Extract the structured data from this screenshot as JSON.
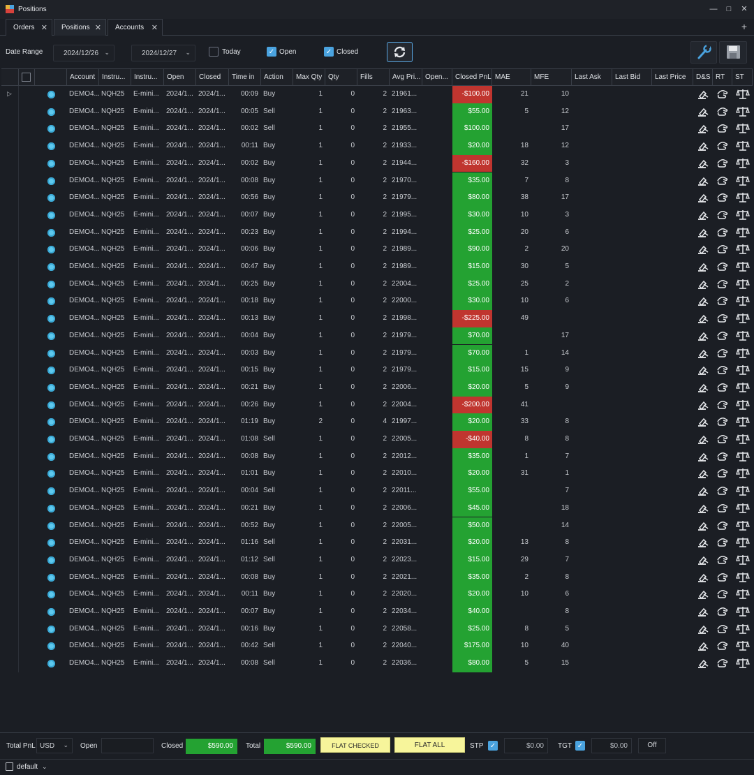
{
  "window": {
    "title": "Positions"
  },
  "tabs": [
    {
      "label": "Orders",
      "active": false
    },
    {
      "label": "Positions",
      "active": true
    },
    {
      "label": "Accounts",
      "active": false
    }
  ],
  "toolbar": {
    "date_range_label": "Date Range",
    "date_from": "2024/12/26",
    "date_to": "2024/12/27",
    "today_label": "Today",
    "today_checked": false,
    "open_label": "Open",
    "open_checked": true,
    "closed_label": "Closed",
    "closed_checked": true
  },
  "columns": [
    "Account",
    "Instru...",
    "Instru...",
    "Open",
    "Closed",
    "Time in",
    "Action",
    "Max Qty",
    "Qty",
    "Fills",
    "Avg Pri...",
    "Open...",
    "Closed PnL",
    "MAE",
    "MFE",
    "Last Ask",
    "Last Bid",
    "Last Price",
    "D&S",
    "RT",
    "ST"
  ],
  "colors": {
    "positive": "#24a232",
    "negative": "#c0352f",
    "accent": "#4aa3df"
  },
  "rows": [
    {
      "account": "DEMO4...",
      "instrument": "NQH25",
      "instrument_name": "E-mini...",
      "open": "2024/1...",
      "closed": "2024/1...",
      "time_in": "00:09",
      "action": "Buy",
      "max_qty": "1",
      "qty": "0",
      "fills": "2",
      "avg_price": "21961...",
      "closed_pnl": "-$100.00",
      "mae": "21",
      "mfe": "10"
    },
    {
      "account": "DEMO4...",
      "instrument": "NQH25",
      "instrument_name": "E-mini...",
      "open": "2024/1...",
      "closed": "2024/1...",
      "time_in": "00:05",
      "action": "Sell",
      "max_qty": "1",
      "qty": "0",
      "fills": "2",
      "avg_price": "21963...",
      "closed_pnl": "$55.00",
      "mae": "5",
      "mfe": "12"
    },
    {
      "account": "DEMO4...",
      "instrument": "NQH25",
      "instrument_name": "E-mini...",
      "open": "2024/1...",
      "closed": "2024/1...",
      "time_in": "00:02",
      "action": "Sell",
      "max_qty": "1",
      "qty": "0",
      "fills": "2",
      "avg_price": "21955...",
      "closed_pnl": "$100.00",
      "mae": "",
      "mfe": "17"
    },
    {
      "account": "DEMO4...",
      "instrument": "NQH25",
      "instrument_name": "E-mini...",
      "open": "2024/1...",
      "closed": "2024/1...",
      "time_in": "00:11",
      "action": "Buy",
      "max_qty": "1",
      "qty": "0",
      "fills": "2",
      "avg_price": "21933...",
      "closed_pnl": "$20.00",
      "mae": "18",
      "mfe": "12"
    },
    {
      "account": "DEMO4...",
      "instrument": "NQH25",
      "instrument_name": "E-mini...",
      "open": "2024/1...",
      "closed": "2024/1...",
      "time_in": "00:02",
      "action": "Buy",
      "max_qty": "1",
      "qty": "0",
      "fills": "2",
      "avg_price": "21944...",
      "closed_pnl": "-$160.00",
      "mae": "32",
      "mfe": "3"
    },
    {
      "account": "DEMO4...",
      "instrument": "NQH25",
      "instrument_name": "E-mini...",
      "open": "2024/1...",
      "closed": "2024/1...",
      "time_in": "00:08",
      "action": "Buy",
      "max_qty": "1",
      "qty": "0",
      "fills": "2",
      "avg_price": "21970...",
      "closed_pnl": "$35.00",
      "mae": "7",
      "mfe": "8"
    },
    {
      "account": "DEMO4...",
      "instrument": "NQH25",
      "instrument_name": "E-mini...",
      "open": "2024/1...",
      "closed": "2024/1...",
      "time_in": "00:56",
      "action": "Buy",
      "max_qty": "1",
      "qty": "0",
      "fills": "2",
      "avg_price": "21979...",
      "closed_pnl": "$80.00",
      "mae": "38",
      "mfe": "17"
    },
    {
      "account": "DEMO4...",
      "instrument": "NQH25",
      "instrument_name": "E-mini...",
      "open": "2024/1...",
      "closed": "2024/1...",
      "time_in": "00:07",
      "action": "Buy",
      "max_qty": "1",
      "qty": "0",
      "fills": "2",
      "avg_price": "21995...",
      "closed_pnl": "$30.00",
      "mae": "10",
      "mfe": "3"
    },
    {
      "account": "DEMO4...",
      "instrument": "NQH25",
      "instrument_name": "E-mini...",
      "open": "2024/1...",
      "closed": "2024/1...",
      "time_in": "00:23",
      "action": "Buy",
      "max_qty": "1",
      "qty": "0",
      "fills": "2",
      "avg_price": "21994...",
      "closed_pnl": "$25.00",
      "mae": "20",
      "mfe": "6"
    },
    {
      "account": "DEMO4...",
      "instrument": "NQH25",
      "instrument_name": "E-mini...",
      "open": "2024/1...",
      "closed": "2024/1...",
      "time_in": "00:06",
      "action": "Buy",
      "max_qty": "1",
      "qty": "0",
      "fills": "2",
      "avg_price": "21989...",
      "closed_pnl": "$90.00",
      "mae": "2",
      "mfe": "20"
    },
    {
      "account": "DEMO4...",
      "instrument": "NQH25",
      "instrument_name": "E-mini...",
      "open": "2024/1...",
      "closed": "2024/1...",
      "time_in": "00:47",
      "action": "Buy",
      "max_qty": "1",
      "qty": "0",
      "fills": "2",
      "avg_price": "21989...",
      "closed_pnl": "$15.00",
      "mae": "30",
      "mfe": "5"
    },
    {
      "account": "DEMO4...",
      "instrument": "NQH25",
      "instrument_name": "E-mini...",
      "open": "2024/1...",
      "closed": "2024/1...",
      "time_in": "00:25",
      "action": "Buy",
      "max_qty": "1",
      "qty": "0",
      "fills": "2",
      "avg_price": "22004...",
      "closed_pnl": "$25.00",
      "mae": "25",
      "mfe": "2"
    },
    {
      "account": "DEMO4...",
      "instrument": "NQH25",
      "instrument_name": "E-mini...",
      "open": "2024/1...",
      "closed": "2024/1...",
      "time_in": "00:18",
      "action": "Buy",
      "max_qty": "1",
      "qty": "0",
      "fills": "2",
      "avg_price": "22000...",
      "closed_pnl": "$30.00",
      "mae": "10",
      "mfe": "6"
    },
    {
      "account": "DEMO4...",
      "instrument": "NQH25",
      "instrument_name": "E-mini...",
      "open": "2024/1...",
      "closed": "2024/1...",
      "time_in": "00:13",
      "action": "Buy",
      "max_qty": "1",
      "qty": "0",
      "fills": "2",
      "avg_price": "21998...",
      "closed_pnl": "-$225.00",
      "mae": "49",
      "mfe": ""
    },
    {
      "account": "DEMO4...",
      "instrument": "NQH25",
      "instrument_name": "E-mini...",
      "open": "2024/1...",
      "closed": "2024/1...",
      "time_in": "00:04",
      "action": "Buy",
      "max_qty": "1",
      "qty": "0",
      "fills": "2",
      "avg_price": "21979...",
      "closed_pnl": "$70.00",
      "mae": "",
      "mfe": "17"
    },
    {
      "account": "DEMO4...",
      "instrument": "NQH25",
      "instrument_name": "E-mini...",
      "open": "2024/1...",
      "closed": "2024/1...",
      "time_in": "00:03",
      "action": "Buy",
      "max_qty": "1",
      "qty": "0",
      "fills": "2",
      "avg_price": "21979...",
      "closed_pnl": "$70.00",
      "mae": "1",
      "mfe": "14"
    },
    {
      "account": "DEMO4...",
      "instrument": "NQH25",
      "instrument_name": "E-mini...",
      "open": "2024/1...",
      "closed": "2024/1...",
      "time_in": "00:15",
      "action": "Buy",
      "max_qty": "1",
      "qty": "0",
      "fills": "2",
      "avg_price": "21979...",
      "closed_pnl": "$15.00",
      "mae": "15",
      "mfe": "9"
    },
    {
      "account": "DEMO4...",
      "instrument": "NQH25",
      "instrument_name": "E-mini...",
      "open": "2024/1...",
      "closed": "2024/1...",
      "time_in": "00:21",
      "action": "Buy",
      "max_qty": "1",
      "qty": "0",
      "fills": "2",
      "avg_price": "22006...",
      "closed_pnl": "$20.00",
      "mae": "5",
      "mfe": "9"
    },
    {
      "account": "DEMO4...",
      "instrument": "NQH25",
      "instrument_name": "E-mini...",
      "open": "2024/1...",
      "closed": "2024/1...",
      "time_in": "00:26",
      "action": "Buy",
      "max_qty": "1",
      "qty": "0",
      "fills": "2",
      "avg_price": "22004...",
      "closed_pnl": "-$200.00",
      "mae": "41",
      "mfe": ""
    },
    {
      "account": "DEMO4...",
      "instrument": "NQH25",
      "instrument_name": "E-mini...",
      "open": "2024/1...",
      "closed": "2024/1...",
      "time_in": "01:19",
      "action": "Buy",
      "max_qty": "2",
      "qty": "0",
      "fills": "4",
      "avg_price": "21997...",
      "closed_pnl": "$20.00",
      "mae": "33",
      "mfe": "8"
    },
    {
      "account": "DEMO4...",
      "instrument": "NQH25",
      "instrument_name": "E-mini...",
      "open": "2024/1...",
      "closed": "2024/1...",
      "time_in": "01:08",
      "action": "Sell",
      "max_qty": "1",
      "qty": "0",
      "fills": "2",
      "avg_price": "22005...",
      "closed_pnl": "-$40.00",
      "mae": "8",
      "mfe": "8"
    },
    {
      "account": "DEMO4...",
      "instrument": "NQH25",
      "instrument_name": "E-mini...",
      "open": "2024/1...",
      "closed": "2024/1...",
      "time_in": "00:08",
      "action": "Buy",
      "max_qty": "1",
      "qty": "0",
      "fills": "2",
      "avg_price": "22012...",
      "closed_pnl": "$35.00",
      "mae": "1",
      "mfe": "7"
    },
    {
      "account": "DEMO4...",
      "instrument": "NQH25",
      "instrument_name": "E-mini...",
      "open": "2024/1...",
      "closed": "2024/1...",
      "time_in": "01:01",
      "action": "Buy",
      "max_qty": "1",
      "qty": "0",
      "fills": "2",
      "avg_price": "22010...",
      "closed_pnl": "$20.00",
      "mae": "31",
      "mfe": "1"
    },
    {
      "account": "DEMO4...",
      "instrument": "NQH25",
      "instrument_name": "E-mini...",
      "open": "2024/1...",
      "closed": "2024/1...",
      "time_in": "00:04",
      "action": "Sell",
      "max_qty": "1",
      "qty": "0",
      "fills": "2",
      "avg_price": "22011...",
      "closed_pnl": "$55.00",
      "mae": "",
      "mfe": "7"
    },
    {
      "account": "DEMO4...",
      "instrument": "NQH25",
      "instrument_name": "E-mini...",
      "open": "2024/1...",
      "closed": "2024/1...",
      "time_in": "00:21",
      "action": "Buy",
      "max_qty": "1",
      "qty": "0",
      "fills": "2",
      "avg_price": "22006...",
      "closed_pnl": "$45.00",
      "mae": "",
      "mfe": "18"
    },
    {
      "account": "DEMO4...",
      "instrument": "NQH25",
      "instrument_name": "E-mini...",
      "open": "2024/1...",
      "closed": "2024/1...",
      "time_in": "00:52",
      "action": "Buy",
      "max_qty": "1",
      "qty": "0",
      "fills": "2",
      "avg_price": "22005...",
      "closed_pnl": "$50.00",
      "mae": "",
      "mfe": "14"
    },
    {
      "account": "DEMO4...",
      "instrument": "NQH25",
      "instrument_name": "E-mini...",
      "open": "2024/1...",
      "closed": "2024/1...",
      "time_in": "01:16",
      "action": "Sell",
      "max_qty": "1",
      "qty": "0",
      "fills": "2",
      "avg_price": "22031...",
      "closed_pnl": "$20.00",
      "mae": "13",
      "mfe": "8"
    },
    {
      "account": "DEMO4...",
      "instrument": "NQH25",
      "instrument_name": "E-mini...",
      "open": "2024/1...",
      "closed": "2024/1...",
      "time_in": "01:12",
      "action": "Sell",
      "max_qty": "1",
      "qty": "0",
      "fills": "2",
      "avg_price": "22023...",
      "closed_pnl": "$15.00",
      "mae": "29",
      "mfe": "7"
    },
    {
      "account": "DEMO4...",
      "instrument": "NQH25",
      "instrument_name": "E-mini...",
      "open": "2024/1...",
      "closed": "2024/1...",
      "time_in": "00:08",
      "action": "Buy",
      "max_qty": "1",
      "qty": "0",
      "fills": "2",
      "avg_price": "22021...",
      "closed_pnl": "$35.00",
      "mae": "2",
      "mfe": "8"
    },
    {
      "account": "DEMO4...",
      "instrument": "NQH25",
      "instrument_name": "E-mini...",
      "open": "2024/1...",
      "closed": "2024/1...",
      "time_in": "00:11",
      "action": "Buy",
      "max_qty": "1",
      "qty": "0",
      "fills": "2",
      "avg_price": "22020...",
      "closed_pnl": "$20.00",
      "mae": "10",
      "mfe": "6"
    },
    {
      "account": "DEMO4...",
      "instrument": "NQH25",
      "instrument_name": "E-mini...",
      "open": "2024/1...",
      "closed": "2024/1...",
      "time_in": "00:07",
      "action": "Buy",
      "max_qty": "1",
      "qty": "0",
      "fills": "2",
      "avg_price": "22034...",
      "closed_pnl": "$40.00",
      "mae": "",
      "mfe": "8"
    },
    {
      "account": "DEMO4...",
      "instrument": "NQH25",
      "instrument_name": "E-mini...",
      "open": "2024/1...",
      "closed": "2024/1...",
      "time_in": "00:16",
      "action": "Buy",
      "max_qty": "1",
      "qty": "0",
      "fills": "2",
      "avg_price": "22058...",
      "closed_pnl": "$25.00",
      "mae": "8",
      "mfe": "5"
    },
    {
      "account": "DEMO4...",
      "instrument": "NQH25",
      "instrument_name": "E-mini...",
      "open": "2024/1...",
      "closed": "2024/1...",
      "time_in": "00:42",
      "action": "Sell",
      "max_qty": "1",
      "qty": "0",
      "fills": "2",
      "avg_price": "22040...",
      "closed_pnl": "$175.00",
      "mae": "10",
      "mfe": "40"
    },
    {
      "account": "DEMO4...",
      "instrument": "NQH25",
      "instrument_name": "E-mini...",
      "open": "2024/1...",
      "closed": "2024/1...",
      "time_in": "00:08",
      "action": "Sell",
      "max_qty": "1",
      "qty": "0",
      "fills": "2",
      "avg_price": "22036...",
      "closed_pnl": "$80.00",
      "mae": "5",
      "mfe": "15"
    }
  ],
  "footer": {
    "total_pnl_label": "Total PnL",
    "currency": "USD",
    "open_label": "Open",
    "open_value": "",
    "closed_label": "Closed",
    "closed_value": "$590.00",
    "total_label": "Total",
    "total_value": "$590.00",
    "flat_checked_label": "FLAT CHECKED",
    "flat_all_label": "FLAT ALL",
    "stp_label": "STP",
    "stp_checked": true,
    "stp_value": "$0.00",
    "tgt_label": "TGT",
    "tgt_checked": true,
    "tgt_value": "$0.00",
    "off_label": "Off"
  },
  "status": {
    "workspace": "default"
  }
}
